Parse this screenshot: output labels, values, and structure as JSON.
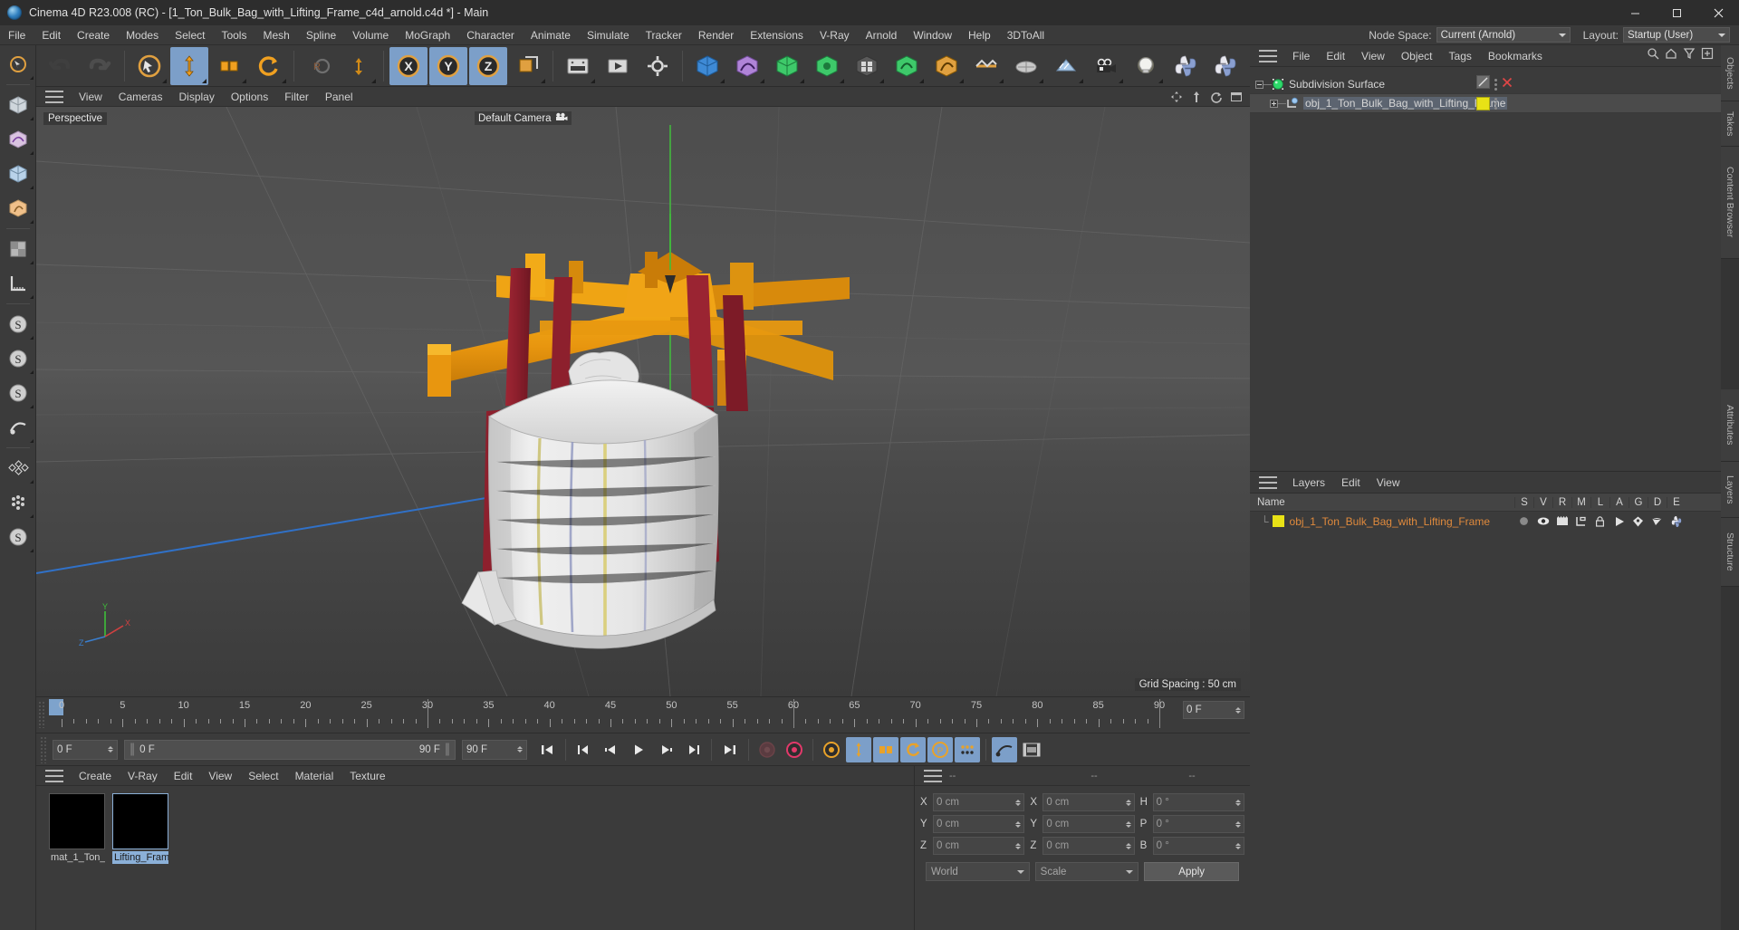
{
  "titlebar": {
    "title": "Cinema 4D R23.008 (RC) - [1_Ton_Bulk_Bag_with_Lifting_Frame_c4d_arnold.c4d *] - Main",
    "app_icon": "cinema4d-logo-icon",
    "minimize": "minimize-icon",
    "maximize": "maximize-icon",
    "close": "close-icon"
  },
  "menubar": {
    "items": [
      "File",
      "Edit",
      "Create",
      "Modes",
      "Select",
      "Tools",
      "Mesh",
      "Spline",
      "Volume",
      "MoGraph",
      "Character",
      "Animate",
      "Simulate",
      "Tracker",
      "Render",
      "Extensions",
      "V-Ray",
      "Arnold",
      "Window",
      "Help",
      "3DToAll"
    ],
    "node_space_label": "Node Space:",
    "node_space_value": "Current (Arnold)",
    "layout_label": "Layout:",
    "layout_value": "Startup (User)"
  },
  "left_toolbar": {
    "items": [
      {
        "name": "live-selection-tool",
        "glyph": "cursor"
      },
      {
        "name": "box-primitive-tool",
        "glyph": "cube"
      },
      {
        "name": "spline-primitive-tool",
        "glyph": "spline"
      },
      {
        "name": "generator-tool",
        "glyph": "cube-nurbs"
      },
      {
        "name": "deformer-tool",
        "glyph": "bend"
      },
      {
        "name": "environment-tool",
        "glyph": "env"
      },
      {
        "name": "camera-tool",
        "glyph": "cam"
      },
      {
        "name": "measure-tool",
        "glyph": "ruler"
      },
      {
        "name": "simulate-particles-tool",
        "glyph": "s1"
      },
      {
        "name": "hair-tool",
        "glyph": "s2"
      },
      {
        "name": "dynamics-tool",
        "glyph": "s3"
      },
      {
        "name": "motion-tracker-tool",
        "glyph": "track"
      },
      {
        "name": "mograph-tool",
        "glyph": "mograph"
      },
      {
        "name": "sculpt-tool",
        "glyph": "sculpt"
      },
      {
        "name": "character-tool",
        "glyph": "char"
      }
    ]
  },
  "top_toolbar": {
    "items": [
      {
        "name": "undo-button",
        "glyph": "undo"
      },
      {
        "name": "redo-button",
        "glyph": "redo"
      },
      {
        "name": "live-selection-button",
        "glyph": "select",
        "active": false
      },
      {
        "name": "move-tool-button",
        "glyph": "move",
        "active": true
      },
      {
        "name": "scale-tool-button",
        "glyph": "scale",
        "active": false
      },
      {
        "name": "rotate-tool-button",
        "glyph": "rotate",
        "active": false
      },
      {
        "name": "render-region-button",
        "glyph": "rregion",
        "active": false
      },
      {
        "name": "move-down-button",
        "glyph": "movedown",
        "active": false
      },
      {
        "name": "lock-x-axis-button",
        "glyph": "X",
        "active": true
      },
      {
        "name": "lock-y-axis-button",
        "glyph": "Y",
        "active": true
      },
      {
        "name": "lock-z-axis-button",
        "glyph": "Z",
        "active": true
      },
      {
        "name": "world-object-coordinates-button",
        "glyph": "world",
        "active": false
      },
      {
        "name": "render-view-button",
        "glyph": "rview",
        "active": false
      },
      {
        "name": "render-to-picture-viewer-button",
        "glyph": "rpicture",
        "active": false
      },
      {
        "name": "render-settings-button",
        "glyph": "rsettings",
        "active": false
      },
      {
        "name": "cube-primitive-button",
        "glyph": "cube",
        "active": false
      },
      {
        "name": "spline-pen-button",
        "glyph": "pen",
        "active": false
      },
      {
        "name": "subdivision-surface-button",
        "glyph": "subdiv",
        "active": false
      },
      {
        "name": "array-button",
        "glyph": "array",
        "active": false
      },
      {
        "name": "mograph-cloner-button",
        "glyph": "cloner",
        "active": false
      },
      {
        "name": "effector-button",
        "glyph": "effector",
        "active": false
      },
      {
        "name": "deformer-bend-button",
        "glyph": "bend",
        "active": false
      },
      {
        "name": "field-button",
        "glyph": "field",
        "active": false
      },
      {
        "name": "floor-button",
        "glyph": "floor",
        "active": false
      },
      {
        "name": "camera-button",
        "glyph": "camera",
        "active": false
      },
      {
        "name": "light-button",
        "glyph": "light",
        "active": false
      },
      {
        "name": "python-script-button",
        "glyph": "python",
        "active": false
      },
      {
        "name": "python-generator-button",
        "glyph": "python",
        "active": false
      }
    ]
  },
  "viewport": {
    "menu_items": [
      "View",
      "Cameras",
      "Display",
      "Options",
      "Filter",
      "Panel"
    ],
    "label": "Perspective",
    "camera_label": "Default Camera",
    "camera_icon": "camera-icon",
    "grid_spacing": "Grid Spacing : 50 cm",
    "axis": {
      "x": "X",
      "y": "Y",
      "z": "Z"
    },
    "right_icons": [
      "move-view-icon",
      "pan-view-icon",
      "rotate-view-icon",
      "maximize-view-icon"
    ]
  },
  "timeline": {
    "tick_labels": [
      "0",
      "5",
      "10",
      "15",
      "20",
      "25",
      "30",
      "35",
      "40",
      "45",
      "50",
      "55",
      "60",
      "65",
      "70",
      "75",
      "80",
      "85",
      "90"
    ],
    "tick_values": [
      0,
      5,
      10,
      15,
      20,
      25,
      30,
      35,
      40,
      45,
      50,
      55,
      60,
      65,
      70,
      75,
      80,
      85,
      90
    ],
    "range_min": 0,
    "range_max": 90,
    "current_frame_field": "0 F",
    "cursor_frames": [
      30,
      60,
      90
    ]
  },
  "playbar": {
    "current_frame": "0 F",
    "range_start": "0 F",
    "range_end": "90 F",
    "preview_end": "90 F",
    "buttons": [
      {
        "name": "go-to-start-button",
        "glyph": "|<"
      },
      {
        "name": "go-to-previous-key-button",
        "glyph": "|<<"
      },
      {
        "name": "go-to-previous-frame-button",
        "glyph": "<|"
      },
      {
        "name": "play-button",
        "glyph": "play"
      },
      {
        "name": "go-to-next-frame-button",
        "glyph": "|>"
      },
      {
        "name": "go-to-next-key-button",
        "glyph": ">>|"
      },
      {
        "name": "go-to-end-button",
        "glyph": ">|"
      },
      {
        "name": "record-active-objects-button",
        "glyph": "record-dim"
      },
      {
        "name": "autokeying-button",
        "glyph": "autokey"
      },
      {
        "name": "keyframe-selection-button",
        "glyph": "keysel"
      },
      {
        "name": "position-key-button",
        "glyph": "poskey",
        "active": true
      },
      {
        "name": "scale-key-button",
        "glyph": "scalekey",
        "active": true
      },
      {
        "name": "rotation-key-button",
        "glyph": "rotkey",
        "active": true
      },
      {
        "name": "parameter-key-button",
        "glyph": "paramkey",
        "active": true
      },
      {
        "name": "point-level-animation-button",
        "glyph": "pla",
        "active": true
      },
      {
        "name": "motion-system-button",
        "glyph": "motion"
      },
      {
        "name": "timeline-button",
        "glyph": "tlbutton"
      }
    ]
  },
  "material_manager": {
    "menu_items": [
      "Create",
      "V-Ray",
      "Edit",
      "View",
      "Select",
      "Material",
      "Texture"
    ],
    "materials": [
      {
        "name": "mat_1_Ton_",
        "selected": false,
        "color": "#000000"
      },
      {
        "name": "Lifting_Fram",
        "selected": true,
        "color": "#000000"
      }
    ]
  },
  "coordinates": {
    "header_dashes": [
      "--",
      "--",
      "--"
    ],
    "position_label_x": "X",
    "position_label_y": "Y",
    "position_label_z": "Z",
    "size_label_x": "X",
    "size_label_y": "Y",
    "size_label_z": "Z",
    "rot_label_h": "H",
    "rot_label_p": "P",
    "rot_label_b": "B",
    "position": [
      "0 cm",
      "0 cm",
      "0 cm"
    ],
    "size": [
      "0 cm",
      "0 cm",
      "0 cm"
    ],
    "rotation": [
      "0 °",
      "0 °",
      "0 °"
    ],
    "coordinate_system": "World",
    "mode": "Scale",
    "apply_label": "Apply"
  },
  "object_manager": {
    "menu_items": [
      "File",
      "Edit",
      "View",
      "Object",
      "Tags",
      "Bookmarks"
    ],
    "right_icons": [
      "search-icon",
      "home-icon",
      "filter-icon",
      "add-icon"
    ],
    "rows": [
      {
        "name": "Subdivision Surface",
        "icon": "subdivision-surface-icon",
        "icon_color": "#2dd96a",
        "tag_color": "#7a7a7a",
        "has_x": true,
        "selected": false,
        "indent": 0,
        "expander": "minus"
      },
      {
        "name": "obj_1_Ton_Bulk_Bag_with_Lifting_Frame",
        "icon": "polygon-object-icon",
        "icon_color": "#9ec8f0",
        "tag_color": "#e8e216",
        "has_x": false,
        "selected": true,
        "indent": 1,
        "expander": "plus"
      }
    ]
  },
  "layers_manager": {
    "menu_items": [
      "Layers",
      "Edit",
      "View"
    ],
    "columns": [
      "Name",
      "S",
      "V",
      "R",
      "M",
      "L",
      "A",
      "G",
      "D",
      "E"
    ],
    "rows": [
      {
        "name": "obj_1_Ton_Bulk_Bag_with_Lifting_Frame",
        "color": "#e8e216",
        "cells": [
          "solo-dot-icon",
          "eye-icon",
          "render-icon",
          "manager-icon",
          "lock-icon",
          "animation-icon",
          "generator-icon",
          "deformer-icon",
          "expression-icon"
        ]
      }
    ]
  },
  "right_tabs": [
    "Objects",
    "Takes",
    "Content Browser",
    "Attributes",
    "Layers",
    "Structure"
  ],
  "colors": {
    "panel_bg": "#3b3b3b",
    "panel_dark": "#2d2d2d",
    "accent_blue": "#7c9fc9",
    "accent_orange": "#e69a2b",
    "highlight_yellow": "#e8e216",
    "layer_text": "#e08a3c"
  }
}
